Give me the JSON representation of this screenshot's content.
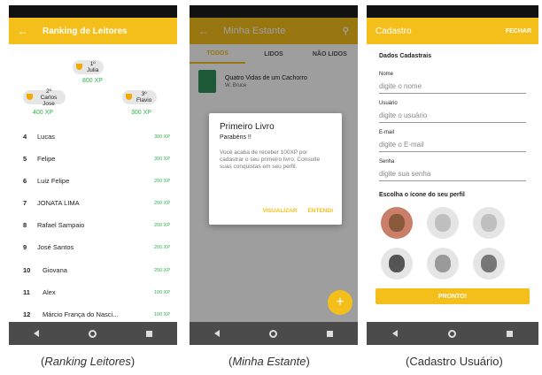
{
  "ranking": {
    "title": "Ranking de Leitores",
    "podium": [
      {
        "place": "1º",
        "name": "Julia",
        "xp": "800 XP"
      },
      {
        "place": "2º",
        "name": "Carlos Jose",
        "xp": "400 XP"
      },
      {
        "place": "3º",
        "name": "Flavio",
        "xp": "300 XP"
      }
    ],
    "rows": [
      {
        "pos": "4",
        "name": "Lucas",
        "xp": "300 XP"
      },
      {
        "pos": "5",
        "name": "Felipe",
        "xp": "300 XP"
      },
      {
        "pos": "6",
        "name": "Luiz Felipe",
        "xp": "200 XP"
      },
      {
        "pos": "7",
        "name": "JONATA LIMA",
        "xp": "200 XP"
      },
      {
        "pos": "8",
        "name": "Rafael Sampaio",
        "xp": "200 XP"
      },
      {
        "pos": "9",
        "name": "José Santos",
        "xp": "200 XP"
      },
      {
        "pos": "10",
        "name": "Giovana",
        "xp": "200 XP"
      },
      {
        "pos": "11",
        "name": "Alex",
        "xp": "100 XP"
      },
      {
        "pos": "12",
        "name": "Márcio França do Nasci...",
        "xp": "100 XP"
      }
    ]
  },
  "estante": {
    "title": "Minha Estante",
    "tabs": [
      "TODOS",
      "LIDOS",
      "NÃO LIDOS"
    ],
    "book": {
      "title": "Quatro Vidas de um Cachorro",
      "author": "W. Bruce"
    },
    "dialog": {
      "title": "Primeiro Livro",
      "subtitle": "Parabéns !!",
      "body": "Você acaba de receber 100XP por cadastrar o seu primeiro livro. Consulte suas conquistas em seu perfil.",
      "visualizar": "VISUALIZAR",
      "entendi": "ENTENDI"
    },
    "fab": "+"
  },
  "cadastro": {
    "title": "Cadastro",
    "fechar": "FECHAR",
    "section": "Dados Cadastrais",
    "fields": {
      "nome": {
        "label": "Nome",
        "placeholder": "digite o nome"
      },
      "usuario": {
        "label": "Usuário",
        "placeholder": "digite o usuário"
      },
      "email": {
        "label": "E-mail",
        "placeholder": "digite o E-mail"
      },
      "senha": {
        "label": "Senha",
        "placeholder": "digite sua senha"
      }
    },
    "icons_label": "Escolha o ícone do seu perfil",
    "pronto": "PRONTO!"
  },
  "captions": {
    "ranking": "Ranking Leitores",
    "estante": "Minha Estante",
    "cadastro": "(Cadastro Usuário)"
  }
}
